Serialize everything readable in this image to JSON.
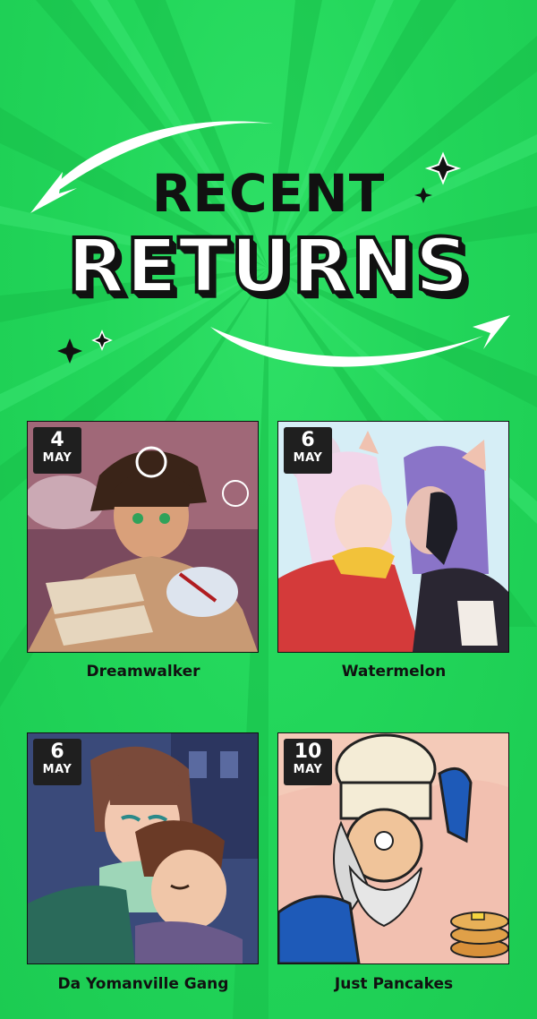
{
  "header": {
    "line1": "RECENT",
    "line2": "RETURNS"
  },
  "colors": {
    "background": "#22d65a",
    "badge": "#1f1f1f",
    "text_dark": "#111111"
  },
  "comics": [
    {
      "title": "Dreamwalker",
      "day": "4",
      "month": "MAY"
    },
    {
      "title": "Watermelon",
      "day": "6",
      "month": "MAY"
    },
    {
      "title": "Da Yomanville Gang",
      "day": "6",
      "month": "MAY"
    },
    {
      "title": "Just Pancakes",
      "day": "10",
      "month": "MAY"
    }
  ]
}
